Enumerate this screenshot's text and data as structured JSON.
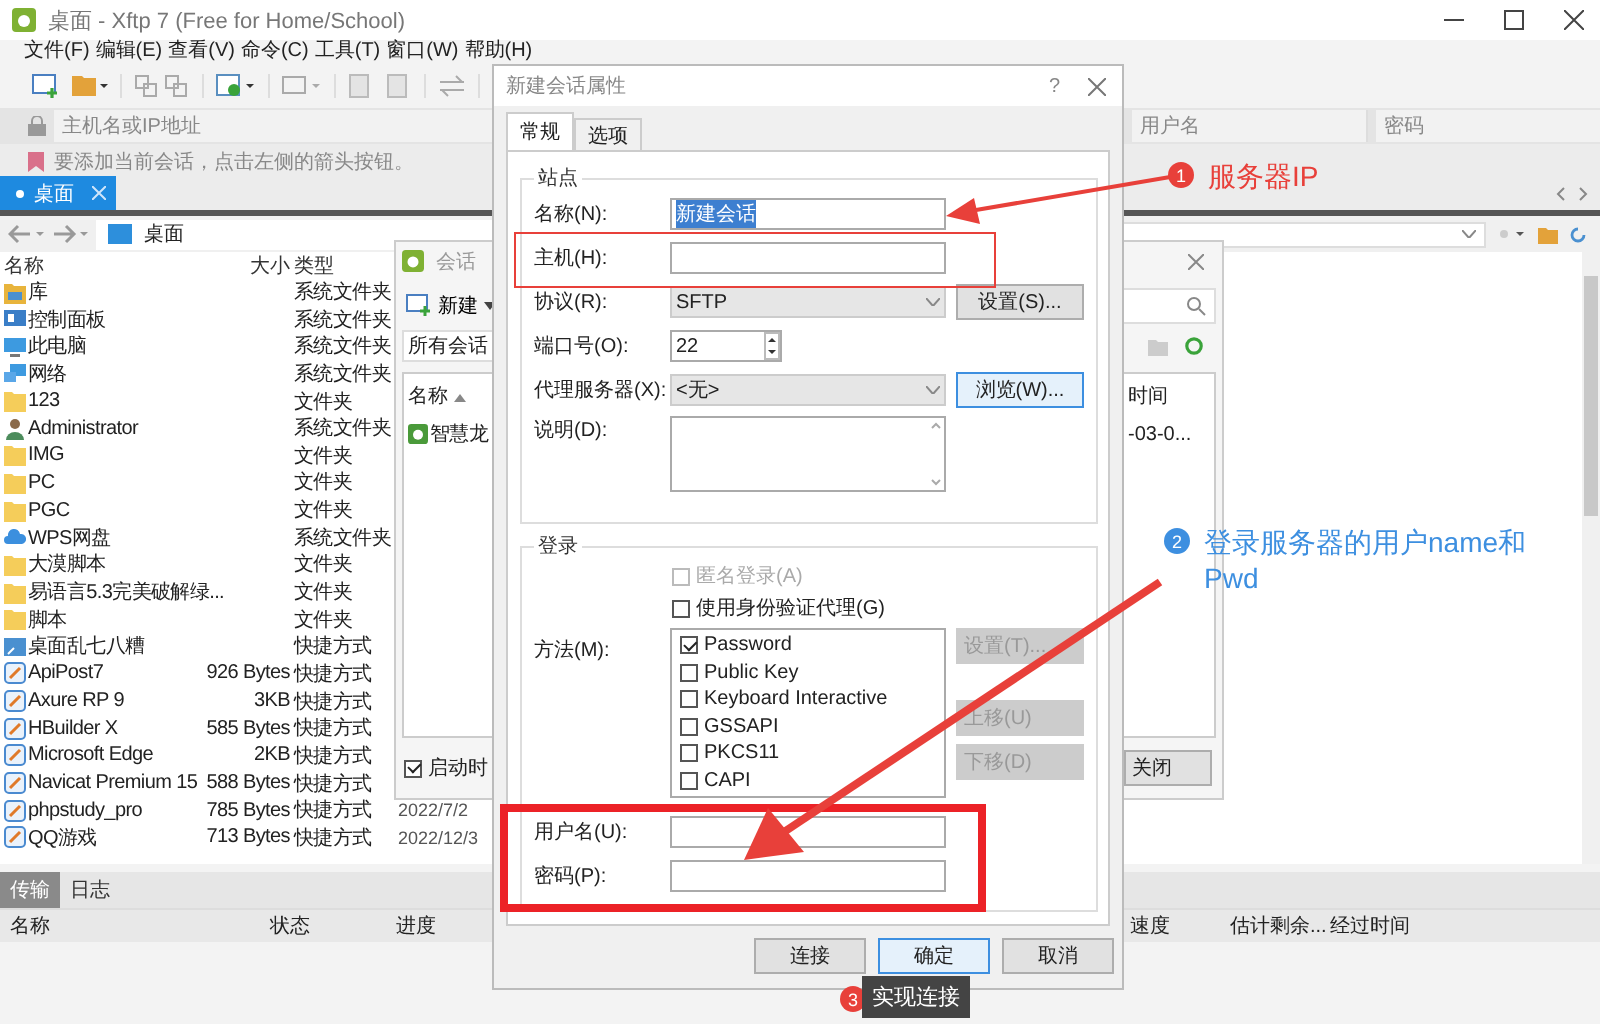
{
  "window": {
    "title": "桌面 - Xftp 7 (Free for Home/School)"
  },
  "menu": [
    "文件(F)",
    "编辑(E)",
    "查看(V)",
    "命令(C)",
    "工具(T)",
    "窗口(W)",
    "帮助(H)"
  ],
  "address": {
    "host_placeholder": "主机名或IP地址",
    "user_placeholder": "用户名",
    "password_placeholder": "密码"
  },
  "hint": "要添加当前会话，点击左侧的箭头按钮。",
  "tabs": [
    {
      "label": "桌面",
      "selected": true
    }
  ],
  "local": {
    "path": "桌面",
    "columns": [
      "名称",
      "大小",
      "类型"
    ],
    "files": [
      {
        "name": "库",
        "kind": "library",
        "type": "系统文件夹"
      },
      {
        "name": "控制面板",
        "kind": "panel",
        "type": "系统文件夹"
      },
      {
        "name": "此电脑",
        "kind": "computer",
        "type": "系统文件夹"
      },
      {
        "name": "网络",
        "kind": "network",
        "type": "系统文件夹"
      },
      {
        "name": "123",
        "kind": "folder",
        "type": "文件夹"
      },
      {
        "name": "Administrator",
        "kind": "user",
        "type": "系统文件夹"
      },
      {
        "name": "IMG",
        "kind": "folder",
        "type": "文件夹"
      },
      {
        "name": "PC",
        "kind": "folder",
        "type": "文件夹"
      },
      {
        "name": "PGC",
        "kind": "folder",
        "type": "文件夹"
      },
      {
        "name": "WPS网盘",
        "kind": "cloud",
        "type": "系统文件夹"
      },
      {
        "name": "大漠脚本",
        "kind": "folder",
        "type": "文件夹"
      },
      {
        "name": "易语言5.3完美破解绿...",
        "kind": "folder",
        "type": "文件夹"
      },
      {
        "name": "脚本",
        "kind": "folder",
        "type": "文件夹"
      },
      {
        "name": "桌面乱七八糟",
        "kind": "shortcut",
        "type": "快捷方式"
      },
      {
        "name": "ApiPost7",
        "kind": "app",
        "size": "926 Bytes",
        "type": "快捷方式"
      },
      {
        "name": "Axure RP 9",
        "kind": "app",
        "size": "3KB",
        "type": "快捷方式"
      },
      {
        "name": "HBuilder X",
        "kind": "app",
        "size": "585 Bytes",
        "type": "快捷方式"
      },
      {
        "name": "Microsoft Edge",
        "kind": "app",
        "size": "2KB",
        "type": "快捷方式"
      },
      {
        "name": "Navicat Premium 15",
        "kind": "app",
        "size": "588 Bytes",
        "type": "快捷方式"
      },
      {
        "name": "phpstudy_pro",
        "kind": "app",
        "size": "785 Bytes",
        "type": "快捷方式",
        "date": "2022/7/2"
      },
      {
        "name": "QQ游戏",
        "kind": "app",
        "size": "713 Bytes",
        "type": "快捷方式",
        "date": "2022/12/3"
      }
    ]
  },
  "transfer": {
    "tabs": [
      {
        "label": "传输",
        "selected": true
      },
      {
        "label": "日志",
        "selected": false
      }
    ],
    "columns": [
      "名称",
      "状态",
      "进度",
      "速度",
      "估计剩余...",
      "经过时间"
    ]
  },
  "sessions": {
    "title": "会话",
    "new_button": "新建",
    "filter": "所有会话",
    "columns": [
      "名称",
      "时间"
    ],
    "rows": [
      {
        "name": "智慧龙",
        "time": "-03-0..."
      }
    ],
    "startup_checkbox": {
      "label": "启动时",
      "checked": true
    },
    "close_button": "关闭"
  },
  "dialog": {
    "title": "新建会话属性",
    "help_button": "?",
    "tabs": [
      {
        "label": "常规",
        "selected": true
      },
      {
        "label": "选项",
        "selected": false
      }
    ],
    "site_group": {
      "title": "站点",
      "fields": [
        {
          "kind": "text",
          "label": "名称(N):",
          "value": "新建会话",
          "value_selected": true
        },
        {
          "kind": "text",
          "label": "主机(H):"
        },
        {
          "kind": "select",
          "label": "协议(R):",
          "value": "SFTP",
          "button": "设置(S)...",
          "button_focused": false
        },
        {
          "kind": "spin",
          "label": "端口号(O):",
          "value": "22"
        },
        {
          "kind": "select",
          "label": "代理服务器(X):",
          "value": "<无>",
          "button": "浏览(W)...",
          "button_focused": true
        },
        {
          "kind": "textarea",
          "label": "说明(D):"
        }
      ]
    },
    "login_group": {
      "title": "登录",
      "options": [
        {
          "label": "匿名登录(A)",
          "checked": false,
          "disabled": true
        },
        {
          "label": "使用身份验证代理(G)",
          "checked": false,
          "disabled": false
        }
      ],
      "method_label": "方法(M):",
      "methods": [
        {
          "label": "Password",
          "checked": true
        },
        {
          "label": "Public Key",
          "checked": false
        },
        {
          "label": "Keyboard Interactive",
          "checked": false
        },
        {
          "label": "GSSAPI",
          "checked": false
        },
        {
          "label": "PKCS11",
          "checked": false
        },
        {
          "label": "CAPI",
          "checked": false
        }
      ],
      "method_buttons": [
        {
          "label": "设置(T)...",
          "disabled": true
        },
        {
          "label": "上移(U)",
          "disabled": true
        },
        {
          "label": "下移(D)",
          "disabled": true
        }
      ],
      "fields": [
        {
          "label": "用户名(U):"
        },
        {
          "label": "密码(P):"
        }
      ]
    },
    "buttons": [
      {
        "label": "连接",
        "default": false
      },
      {
        "label": "确定",
        "default": true
      },
      {
        "label": "取消",
        "default": false
      }
    ]
  },
  "annotations": [
    {
      "kind": "label",
      "number": "1",
      "text": "服务器IP",
      "color": "#e8403a"
    },
    {
      "kind": "label",
      "number": "2",
      "text": "登录服务器的用户name和Pwd",
      "color": "#3d8fe0"
    },
    {
      "kind": "tooltip",
      "number": "3",
      "text": "实现连接",
      "color": "#e8403a"
    }
  ]
}
